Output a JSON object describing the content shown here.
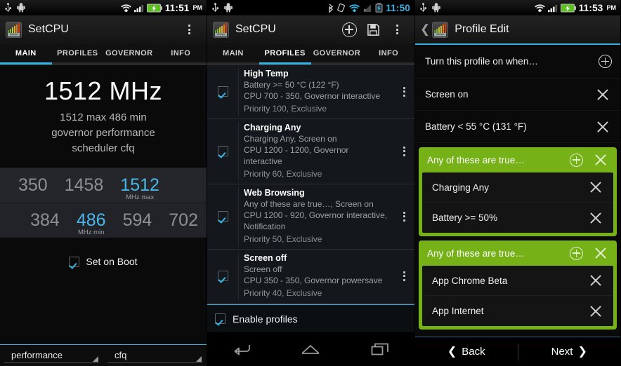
{
  "panel1": {
    "statusbar": {
      "icons": [
        "usb-icon",
        "adb-icon"
      ],
      "right_icons": [
        "wifi-icon",
        "signal-icon",
        "battery-charging-icon"
      ],
      "time": "11:51",
      "ampm": "PM"
    },
    "actionbar": {
      "app_icon": "setcpu-icon",
      "title": "SetCPU",
      "overflow": "overflow-menu-icon"
    },
    "tabs": [
      {
        "label": "MAIN",
        "active": true
      },
      {
        "label": "PROFILES",
        "active": false
      },
      {
        "label": "GOVERNOR",
        "active": false
      },
      {
        "label": "INFO",
        "active": false
      }
    ],
    "main": {
      "big_frequency": "1512 MHz",
      "summary_lines": [
        "1512 max 486 min",
        "governor performance",
        "scheduler cfq"
      ],
      "max_picker": {
        "values": [
          "350",
          "1458",
          "1512"
        ],
        "selected": "1512",
        "selected_label": "MHz max"
      },
      "min_picker": {
        "values": [
          "384",
          "486",
          "594",
          "702"
        ],
        "selected": "486",
        "selected_label": "MHz min"
      },
      "set_on_boot": {
        "label": "Set on Boot",
        "checked": true
      },
      "governor_spinner": "performance",
      "scheduler_spinner": "cfq"
    }
  },
  "panel2": {
    "statusbar": {
      "icons": [
        "usb-icon",
        "adb-icon"
      ],
      "right_icons": [
        "bluetooth-icon",
        "rotation-lock-icon",
        "wifi-icon",
        "signal-off-icon",
        "battery-charging-icon"
      ],
      "time": "11:50",
      "time_color": "#33b5e5"
    },
    "actionbar": {
      "app_icon": "setcpu-icon",
      "title": "SetCPU",
      "add_label": "add-profile-icon",
      "save_label": "save-icon",
      "overflow": "overflow-menu-icon"
    },
    "tabs": [
      {
        "label": "MAIN",
        "active": false
      },
      {
        "label": "PROFILES",
        "active": true
      },
      {
        "label": "GOVERNOR",
        "active": false
      },
      {
        "label": "INFO",
        "active": false
      }
    ],
    "profiles": [
      {
        "title": "High Temp",
        "condition": "Battery >= 50 °C (122 °F)",
        "settings": "CPU 700 - 350, Governor interactive",
        "priority": "Priority 100, Exclusive",
        "checked": true
      },
      {
        "title": "Charging Any",
        "condition": "Charging Any, Screen on",
        "settings": "CPU 1200 - 1200, Governor interactive",
        "priority": "Priority 60, Exclusive",
        "checked": true
      },
      {
        "title": "Web Browsing",
        "condition": "Any of these are true…, Screen on",
        "settings": "CPU 1200 - 920, Governor interactive, Notification",
        "priority": "Priority 50, Exclusive",
        "checked": true
      },
      {
        "title": "Screen off",
        "condition": "Screen off",
        "settings": "CPU 350 - 350, Governor powersave",
        "priority": "Priority 40, Exclusive",
        "checked": true
      }
    ],
    "enable_profiles": {
      "label": "Enable profiles",
      "checked": true
    },
    "navbar": [
      "back-icon",
      "home-icon",
      "recents-icon"
    ]
  },
  "panel3": {
    "statusbar": {
      "icons": [
        "usb-icon",
        "adb-icon"
      ],
      "right_icons": [
        "wifi-icon",
        "signal-icon",
        "battery-charging-icon"
      ],
      "time": "11:53",
      "ampm": "PM"
    },
    "actionbar": {
      "up_icon": "back-chevron-icon",
      "app_icon": "setcpu-icon",
      "title": "Profile Edit"
    },
    "header_row": {
      "label": "Turn this profile on when…",
      "action": "add-condition-icon"
    },
    "conditions": [
      {
        "label": "Screen on",
        "action": "remove-icon"
      },
      {
        "label": "Battery < 55 °C (131 °F)",
        "action": "remove-icon"
      }
    ],
    "groups": [
      {
        "header": "Any of these are true…",
        "color": "#76b117",
        "items": [
          {
            "label": "Charging Any"
          },
          {
            "label": "Battery >= 50%"
          }
        ]
      },
      {
        "header": "Any of these are true…",
        "color": "#76b117",
        "items": [
          {
            "label": "App Chrome Beta"
          },
          {
            "label": "App Internet"
          }
        ]
      }
    ],
    "bottom_nav": {
      "back": "Back",
      "next": "Next"
    }
  }
}
